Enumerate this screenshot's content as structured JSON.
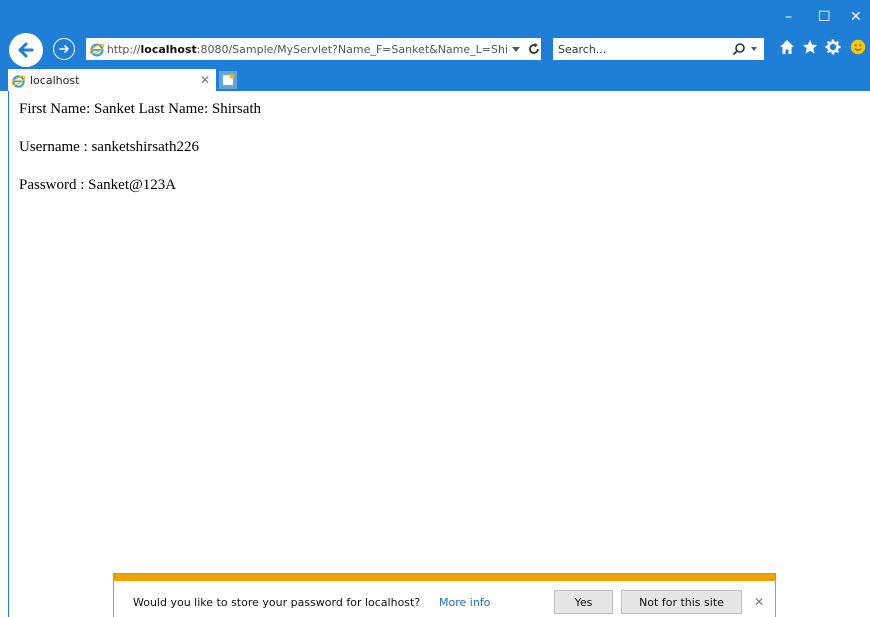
{
  "window": {
    "minimize_glyph": "–",
    "maximize_glyph": "☐",
    "close_glyph": "✕"
  },
  "address": {
    "prefix": "http://",
    "host": "localhost",
    "rest": ":8080/Sample/MyServlet?Name_F=Sanket&Name_L=Shi"
  },
  "search": {
    "placeholder": "Search..."
  },
  "tab": {
    "title": "localhost"
  },
  "page": {
    "line1": "First Name: Sanket Last Name: Shirsath",
    "line2": "Username : sanketshirsath226",
    "line3": "Password : Sanket@123A"
  },
  "notification": {
    "message": "Would you like to store your password for localhost?",
    "link": "More info",
    "yes_label": "Yes",
    "not_label": "Not for this site"
  },
  "colors": {
    "chrome": "#1f7fd6",
    "notification_bar": "#f0a400",
    "link": "#1a6fc9"
  },
  "icons": [
    "back-arrow-icon",
    "forward-arrow-icon",
    "ie-logo-icon",
    "dropdown-arrow-icon",
    "refresh-icon",
    "search-icon",
    "home-icon",
    "favorites-star-icon",
    "settings-gear-icon",
    "smiley-feedback-icon",
    "new-tab-icon",
    "close-icon"
  ]
}
